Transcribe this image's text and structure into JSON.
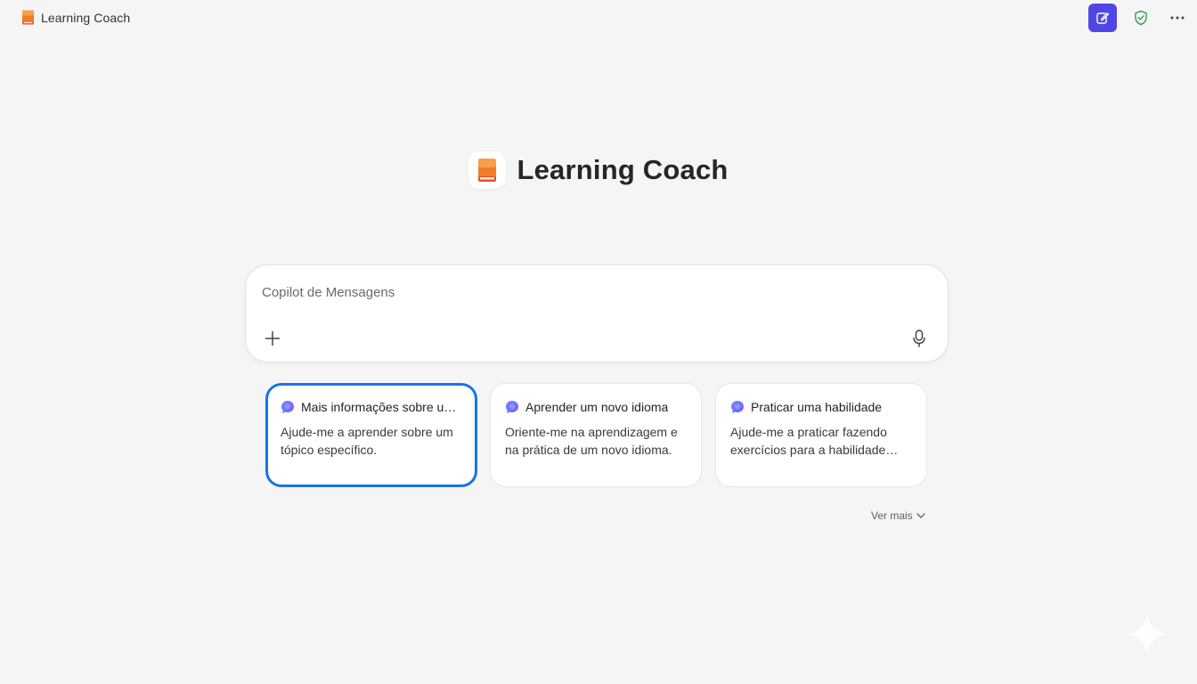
{
  "window": {
    "title": "Learning Coach",
    "icon": "book-icon"
  },
  "toolbar": {
    "new_chat_icon": "edit-icon",
    "privacy_icon": "shield-check-icon",
    "more_icon": "more-horizontal-icon"
  },
  "hero": {
    "title": "Learning Coach",
    "icon": "book-icon"
  },
  "composer": {
    "placeholder": "Copilot de Mensagens",
    "value": "",
    "add_icon": "plus-icon",
    "mic_icon": "microphone-icon"
  },
  "suggestions": [
    {
      "title": "Mais informações sobre um...",
      "body": "Ajude-me a aprender sobre um tópico específico.",
      "selected": true
    },
    {
      "title": "Aprender um novo idioma",
      "body": "Oriente-me na aprendizagem e na prática de um novo idioma.",
      "selected": false
    },
    {
      "title": "Praticar uma habilidade",
      "body": "Ajude-me a praticar fazendo exercícios para a habilidade qu...",
      "selected": false
    }
  ],
  "see_more": {
    "label": "Ver mais",
    "icon": "chevron-down-icon"
  },
  "colors": {
    "background": "#f5f5f5",
    "accent": "#4f46e5",
    "selected_border": "#1a73e8",
    "shield": "#3aa35a"
  }
}
